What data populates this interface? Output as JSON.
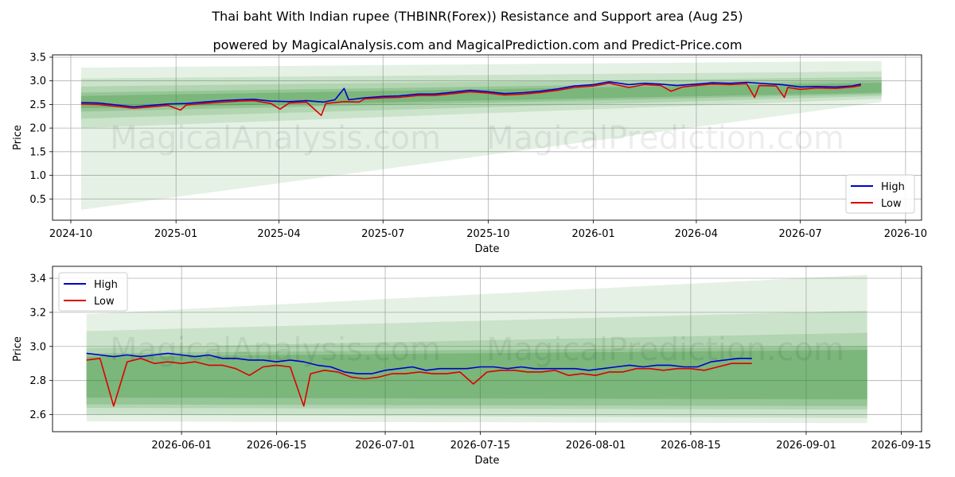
{
  "title": "Thai baht With Indian rupee (THBINR(Forex)) Resistance and Support area (Aug 25)",
  "subtitle": "powered by MagicalAnalysis.com and MagicalPrediction.com and Predict-Price.com",
  "watermarks": [
    "MagicalAnalysis.com",
    "MagicalPrediction.com"
  ],
  "colors": {
    "high": "#0000cc",
    "low": "#dd0000",
    "band": "#2e8b2e",
    "grid": "#b0b0b0"
  },
  "chart_data": [
    {
      "type": "line",
      "xlabel": "Date",
      "ylabel": "Price",
      "xlim": [
        "2024-09-15",
        "2026-10-15"
      ],
      "ylim": [
        0.05,
        3.55
      ],
      "x_ticks": [
        "2024-10",
        "2025-01",
        "2025-04",
        "2025-07",
        "2025-10",
        "2026-01",
        "2026-04",
        "2026-07",
        "2026-10"
      ],
      "x_tick_dates": [
        "2024-10-01",
        "2025-01-01",
        "2025-04-01",
        "2025-07-01",
        "2025-10-01",
        "2026-01-01",
        "2026-04-01",
        "2026-07-01",
        "2026-10-01"
      ],
      "y_ticks": [
        "0.5",
        "1.0",
        "1.5",
        "2.0",
        "2.5",
        "3.0",
        "3.5"
      ],
      "grid": true,
      "legend": {
        "position": "lower right",
        "entries": [
          "High",
          "Low"
        ]
      },
      "bands": {
        "x_start": "2024-10-10",
        "x_end": "2026-09-10",
        "layers": [
          {
            "start": [
              0.27,
              3.28
            ],
            "end": [
              2.55,
              3.42
            ],
            "opacity": 0.12
          },
          {
            "start": [
              2.0,
              3.05
            ],
            "end": [
              2.62,
              3.2
            ],
            "opacity": 0.14
          },
          {
            "start": [
              2.2,
              2.88
            ],
            "end": [
              2.68,
              3.08
            ],
            "opacity": 0.16
          },
          {
            "start": [
              2.35,
              2.75
            ],
            "end": [
              2.72,
              3.0
            ],
            "opacity": 0.2
          },
          {
            "start": [
              2.42,
              2.68
            ],
            "end": [
              2.75,
              2.96
            ],
            "opacity": 0.26
          }
        ]
      },
      "series": [
        {
          "name": "High",
          "points": [
            [
              "2024-10-10",
              2.54
            ],
            [
              "2024-10-25",
              2.53
            ],
            [
              "2024-11-10",
              2.49
            ],
            [
              "2024-11-25",
              2.45
            ],
            [
              "2024-12-10",
              2.48
            ],
            [
              "2024-12-25",
              2.51
            ],
            [
              "2025-01-10",
              2.52
            ],
            [
              "2025-01-25",
              2.55
            ],
            [
              "2025-02-10",
              2.58
            ],
            [
              "2025-02-25",
              2.6
            ],
            [
              "2025-03-10",
              2.61
            ],
            [
              "2025-03-25",
              2.57
            ],
            [
              "2025-04-10",
              2.56
            ],
            [
              "2025-04-25",
              2.58
            ],
            [
              "2025-05-10",
              2.55
            ],
            [
              "2025-05-20",
              2.6
            ],
            [
              "2025-05-28",
              2.84
            ],
            [
              "2025-06-01",
              2.6
            ],
            [
              "2025-06-15",
              2.64
            ],
            [
              "2025-07-01",
              2.67
            ],
            [
              "2025-07-15",
              2.68
            ],
            [
              "2025-08-01",
              2.72
            ],
            [
              "2025-08-15",
              2.72
            ],
            [
              "2025-09-01",
              2.76
            ],
            [
              "2025-09-15",
              2.8
            ],
            [
              "2025-10-01",
              2.77
            ],
            [
              "2025-10-15",
              2.73
            ],
            [
              "2025-11-01",
              2.75
            ],
            [
              "2025-11-15",
              2.78
            ],
            [
              "2025-12-01",
              2.83
            ],
            [
              "2025-12-15",
              2.89
            ],
            [
              "2026-01-01",
              2.92
            ],
            [
              "2026-01-15",
              2.98
            ],
            [
              "2026-02-01",
              2.92
            ],
            [
              "2026-02-15",
              2.95
            ],
            [
              "2026-03-01",
              2.93
            ],
            [
              "2026-03-15",
              2.9
            ],
            [
              "2026-04-01",
              2.93
            ],
            [
              "2026-04-15",
              2.96
            ],
            [
              "2026-05-01",
              2.95
            ],
            [
              "2026-05-15",
              2.97
            ],
            [
              "2026-06-01",
              2.94
            ],
            [
              "2026-06-15",
              2.92
            ],
            [
              "2026-07-01",
              2.87
            ],
            [
              "2026-07-15",
              2.88
            ],
            [
              "2026-08-01",
              2.87
            ],
            [
              "2026-08-15",
              2.89
            ],
            [
              "2026-08-23",
              2.93
            ]
          ]
        },
        {
          "name": "Low",
          "points": [
            [
              "2024-10-10",
              2.51
            ],
            [
              "2024-10-25",
              2.5
            ],
            [
              "2024-11-10",
              2.46
            ],
            [
              "2024-11-25",
              2.42
            ],
            [
              "2024-12-10",
              2.45
            ],
            [
              "2024-12-25",
              2.48
            ],
            [
              "2025-01-05",
              2.38
            ],
            [
              "2025-01-10",
              2.49
            ],
            [
              "2025-01-25",
              2.52
            ],
            [
              "2025-02-10",
              2.55
            ],
            [
              "2025-02-25",
              2.57
            ],
            [
              "2025-03-10",
              2.58
            ],
            [
              "2025-03-25",
              2.52
            ],
            [
              "2025-04-02",
              2.4
            ],
            [
              "2025-04-10",
              2.53
            ],
            [
              "2025-04-25",
              2.55
            ],
            [
              "2025-05-08",
              2.27
            ],
            [
              "2025-05-12",
              2.52
            ],
            [
              "2025-05-28",
              2.56
            ],
            [
              "2025-06-10",
              2.55
            ],
            [
              "2025-06-15",
              2.62
            ],
            [
              "2025-07-01",
              2.64
            ],
            [
              "2025-07-15",
              2.65
            ],
            [
              "2025-08-01",
              2.69
            ],
            [
              "2025-08-15",
              2.69
            ],
            [
              "2025-09-01",
              2.73
            ],
            [
              "2025-09-15",
              2.77
            ],
            [
              "2025-10-01",
              2.74
            ],
            [
              "2025-10-15",
              2.7
            ],
            [
              "2025-11-01",
              2.72
            ],
            [
              "2025-11-15",
              2.75
            ],
            [
              "2025-12-01",
              2.8
            ],
            [
              "2025-12-15",
              2.86
            ],
            [
              "2026-01-01",
              2.89
            ],
            [
              "2026-01-15",
              2.95
            ],
            [
              "2026-02-01",
              2.86
            ],
            [
              "2026-02-15",
              2.92
            ],
            [
              "2026-03-01",
              2.9
            ],
            [
              "2026-03-10",
              2.78
            ],
            [
              "2026-03-20",
              2.87
            ],
            [
              "2026-04-01",
              2.9
            ],
            [
              "2026-04-15",
              2.93
            ],
            [
              "2026-05-01",
              2.92
            ],
            [
              "2026-05-15",
              2.94
            ],
            [
              "2026-05-22",
              2.65
            ],
            [
              "2026-05-26",
              2.9
            ],
            [
              "2026-06-10",
              2.89
            ],
            [
              "2026-06-17",
              2.65
            ],
            [
              "2026-06-20",
              2.86
            ],
            [
              "2026-07-01",
              2.82
            ],
            [
              "2026-07-15",
              2.85
            ],
            [
              "2026-08-01",
              2.84
            ],
            [
              "2026-08-15",
              2.87
            ],
            [
              "2026-08-23",
              2.9
            ]
          ]
        }
      ]
    },
    {
      "type": "line",
      "xlabel": "Date",
      "ylabel": "Price",
      "xlim": [
        "2026-05-13",
        "2026-09-18"
      ],
      "ylim": [
        2.5,
        3.47
      ],
      "x_ticks": [
        "2026-06-01",
        "2026-06-15",
        "2026-07-01",
        "2026-07-15",
        "2026-08-01",
        "2026-08-15",
        "2026-09-01",
        "2026-09-15"
      ],
      "y_ticks": [
        "2.6",
        "2.8",
        "3.0",
        "3.2",
        "3.4"
      ],
      "grid": true,
      "legend": {
        "position": "upper left",
        "entries": [
          "High",
          "Low"
        ]
      },
      "bands": {
        "x_start": "2026-05-18",
        "x_end": "2026-09-10",
        "layers": [
          {
            "start": [
              2.56,
              3.19
            ],
            "end": [
              2.55,
              3.42
            ],
            "opacity": 0.12
          },
          {
            "start": [
              2.6,
              3.09
            ],
            "end": [
              2.58,
              3.21
            ],
            "opacity": 0.14
          },
          {
            "start": [
              2.64,
              2.99
            ],
            "end": [
              2.63,
              3.08
            ],
            "opacity": 0.16
          },
          {
            "start": [
              2.66,
              2.96
            ],
            "end": [
              2.65,
              3.0
            ],
            "opacity": 0.2
          },
          {
            "start": [
              2.7,
              2.94
            ],
            "end": [
              2.69,
              2.98
            ],
            "opacity": 0.26
          }
        ]
      },
      "series": [
        {
          "name": "High",
          "points": [
            [
              "2026-05-18",
              2.96
            ],
            [
              "2026-05-20",
              2.95
            ],
            [
              "2026-05-22",
              2.94
            ],
            [
              "2026-05-24",
              2.95
            ],
            [
              "2026-05-26",
              2.94
            ],
            [
              "2026-05-28",
              2.95
            ],
            [
              "2026-05-30",
              2.96
            ],
            [
              "2026-06-01",
              2.95
            ],
            [
              "2026-06-03",
              2.94
            ],
            [
              "2026-06-05",
              2.95
            ],
            [
              "2026-06-07",
              2.93
            ],
            [
              "2026-06-09",
              2.93
            ],
            [
              "2026-06-11",
              2.92
            ],
            [
              "2026-06-13",
              2.92
            ],
            [
              "2026-06-15",
              2.91
            ],
            [
              "2026-06-17",
              2.92
            ],
            [
              "2026-06-19",
              2.91
            ],
            [
              "2026-06-21",
              2.89
            ],
            [
              "2026-06-23",
              2.88
            ],
            [
              "2026-06-25",
              2.85
            ],
            [
              "2026-06-27",
              2.84
            ],
            [
              "2026-06-29",
              2.84
            ],
            [
              "2026-07-01",
              2.86
            ],
            [
              "2026-07-03",
              2.87
            ],
            [
              "2026-07-05",
              2.88
            ],
            [
              "2026-07-07",
              2.86
            ],
            [
              "2026-07-09",
              2.87
            ],
            [
              "2026-07-11",
              2.87
            ],
            [
              "2026-07-13",
              2.87
            ],
            [
              "2026-07-15",
              2.88
            ],
            [
              "2026-07-17",
              2.88
            ],
            [
              "2026-07-19",
              2.87
            ],
            [
              "2026-07-21",
              2.88
            ],
            [
              "2026-07-23",
              2.87
            ],
            [
              "2026-07-25",
              2.87
            ],
            [
              "2026-07-27",
              2.87
            ],
            [
              "2026-07-29",
              2.87
            ],
            [
              "2026-07-31",
              2.86
            ],
            [
              "2026-08-02",
              2.87
            ],
            [
              "2026-08-04",
              2.88
            ],
            [
              "2026-08-06",
              2.89
            ],
            [
              "2026-08-08",
              2.88
            ],
            [
              "2026-08-10",
              2.89
            ],
            [
              "2026-08-12",
              2.89
            ],
            [
              "2026-08-14",
              2.88
            ],
            [
              "2026-08-16",
              2.88
            ],
            [
              "2026-08-18",
              2.91
            ],
            [
              "2026-08-20",
              2.92
            ],
            [
              "2026-08-22",
              2.93
            ],
            [
              "2026-08-24",
              2.93
            ]
          ]
        },
        {
          "name": "Low",
          "points": [
            [
              "2026-05-18",
              2.92
            ],
            [
              "2026-05-20",
              2.93
            ],
            [
              "2026-05-22",
              2.65
            ],
            [
              "2026-05-24",
              2.91
            ],
            [
              "2026-05-26",
              2.93
            ],
            [
              "2026-05-28",
              2.9
            ],
            [
              "2026-05-30",
              2.91
            ],
            [
              "2026-06-01",
              2.9
            ],
            [
              "2026-06-03",
              2.91
            ],
            [
              "2026-06-05",
              2.89
            ],
            [
              "2026-06-07",
              2.89
            ],
            [
              "2026-06-09",
              2.87
            ],
            [
              "2026-06-11",
              2.83
            ],
            [
              "2026-06-13",
              2.88
            ],
            [
              "2026-06-15",
              2.89
            ],
            [
              "2026-06-17",
              2.88
            ],
            [
              "2026-06-19",
              2.65
            ],
            [
              "2026-06-20",
              2.84
            ],
            [
              "2026-06-22",
              2.86
            ],
            [
              "2026-06-24",
              2.85
            ],
            [
              "2026-06-26",
              2.82
            ],
            [
              "2026-06-28",
              2.81
            ],
            [
              "2026-06-30",
              2.82
            ],
            [
              "2026-07-02",
              2.84
            ],
            [
              "2026-07-04",
              2.84
            ],
            [
              "2026-07-06",
              2.85
            ],
            [
              "2026-07-08",
              2.84
            ],
            [
              "2026-07-10",
              2.84
            ],
            [
              "2026-07-12",
              2.85
            ],
            [
              "2026-07-14",
              2.78
            ],
            [
              "2026-07-16",
              2.85
            ],
            [
              "2026-07-18",
              2.86
            ],
            [
              "2026-07-20",
              2.86
            ],
            [
              "2026-07-22",
              2.85
            ],
            [
              "2026-07-24",
              2.85
            ],
            [
              "2026-07-26",
              2.86
            ],
            [
              "2026-07-28",
              2.83
            ],
            [
              "2026-07-30",
              2.84
            ],
            [
              "2026-08-01",
              2.83
            ],
            [
              "2026-08-03",
              2.85
            ],
            [
              "2026-08-05",
              2.85
            ],
            [
              "2026-08-07",
              2.87
            ],
            [
              "2026-08-09",
              2.87
            ],
            [
              "2026-08-11",
              2.86
            ],
            [
              "2026-08-13",
              2.87
            ],
            [
              "2026-08-15",
              2.87
            ],
            [
              "2026-08-17",
              2.86
            ],
            [
              "2026-08-19",
              2.88
            ],
            [
              "2026-08-21",
              2.9
            ],
            [
              "2026-08-24",
              2.9
            ]
          ]
        }
      ]
    }
  ]
}
